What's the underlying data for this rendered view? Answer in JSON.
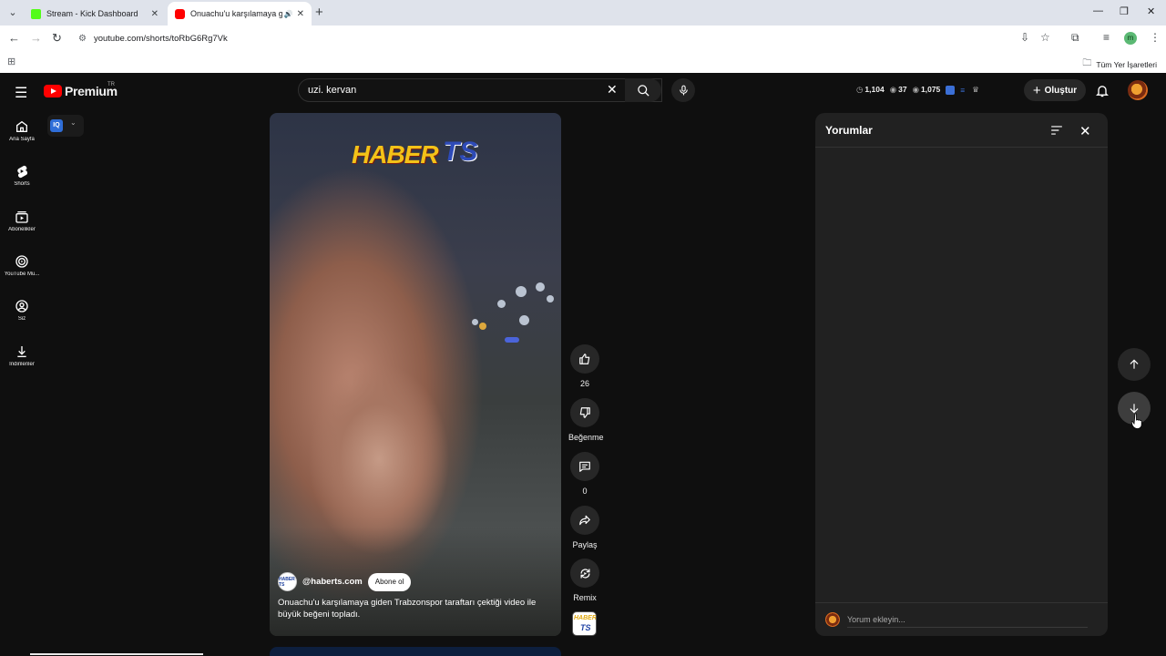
{
  "browser": {
    "tabs": [
      {
        "title": "Stream - Kick Dashboard",
        "favicon_color": "#53fc18",
        "active": false
      },
      {
        "title": "Onuachu'u karşılamaya gid",
        "favicon_color": "#ff0000",
        "active": true
      }
    ],
    "url": "youtube.com/shorts/toRbG6Rg7Vk",
    "bookmarks_label": "Tüm Yer İşaretleri",
    "profile_initial": "m"
  },
  "masthead": {
    "logo_text": "Premium",
    "region": "TR",
    "search_value": "uzi. kervan",
    "stats": {
      "views": "1,104",
      "eye_count": "37",
      "eye_count2": "1,075"
    },
    "create_label": "Oluştur"
  },
  "guide": {
    "items": [
      {
        "label": "Ana Sayfa",
        "icon": "home-icon"
      },
      {
        "label": "Shorts",
        "icon": "shorts-icon"
      },
      {
        "label": "Abonelikler",
        "icon": "subscriptions-icon"
      },
      {
        "label": "YouTube Mu...",
        "icon": "youtube-music-icon"
      },
      {
        "label": "Siz",
        "icon": "you-icon"
      },
      {
        "label": "İndirilenler",
        "icon": "download-icon"
      }
    ],
    "extension_label": "IQ"
  },
  "short": {
    "overlay_logo": {
      "word": "HABER",
      "mark": "TS"
    },
    "channel_handle": "@haberts.com",
    "subscribe_label": "Abone ol",
    "caption": "Onuachu'u karşılamaya giden Trabzonspor taraftarı çektiği video ile büyük beğeni topladı.",
    "channel_avatar_text": "HABER TS"
  },
  "actions": {
    "like_count": "26",
    "dislike_label": "Beğenme",
    "comment_count": "0",
    "share_label": "Paylaş",
    "remix_label": "Remix"
  },
  "comments": {
    "title": "Yorumlar",
    "placeholder": "Yorum ekleyin..."
  },
  "colors": {
    "background": "#0f0f0f",
    "panel": "#212121",
    "brand_red": "#ff0000"
  }
}
